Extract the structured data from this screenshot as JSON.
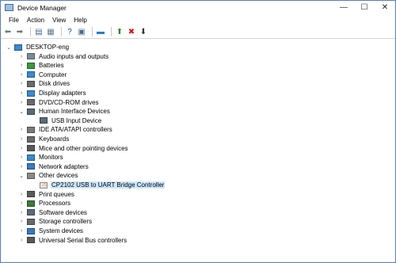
{
  "window": {
    "title": "Device Manager"
  },
  "menu": [
    "File",
    "Action",
    "View",
    "Help"
  ],
  "toolbar": [
    {
      "name": "back-arrow-icon",
      "glyph": "⬅",
      "color": "#6a7a8a"
    },
    {
      "name": "forward-arrow-icon",
      "glyph": "➡",
      "color": "#6a7a8a"
    },
    {
      "sep": true
    },
    {
      "name": "properties-icon",
      "glyph": "▤",
      "color": "#4a6a8a"
    },
    {
      "name": "show-hide-tree-icon",
      "glyph": "▦",
      "color": "#6a7a8a"
    },
    {
      "sep": true
    },
    {
      "name": "help-icon",
      "glyph": "?",
      "color": "#1a4fa0"
    },
    {
      "name": "console-icon",
      "glyph": "▣",
      "color": "#4a6a8a"
    },
    {
      "sep": true
    },
    {
      "name": "scan-hardware-icon",
      "glyph": "▬",
      "color": "#2a7ad0"
    },
    {
      "sep": true
    },
    {
      "name": "update-driver-icon",
      "glyph": "⬆",
      "color": "#2a8a3a"
    },
    {
      "name": "uninstall-icon",
      "glyph": "✖",
      "color": "#d01818"
    },
    {
      "name": "disable-icon",
      "glyph": "⬇",
      "color": "#333333"
    }
  ],
  "tree": {
    "root": "DESKTOP-eng",
    "items": [
      {
        "label": "Audio inputs and outputs",
        "icon": "speaker-icon",
        "color": "#7a8a99",
        "state": "collapsed",
        "level": 1
      },
      {
        "label": "Batteries",
        "icon": "battery-icon",
        "color": "#3a9a3a",
        "state": "collapsed",
        "level": 1
      },
      {
        "label": "Computer",
        "icon": "computer-icon",
        "color": "#3a8ad0",
        "state": "collapsed",
        "level": 1
      },
      {
        "label": "Disk drives",
        "icon": "disk-drive-icon",
        "color": "#6a6a6a",
        "state": "collapsed",
        "level": 1
      },
      {
        "label": "Display adapters",
        "icon": "display-adapter-icon",
        "color": "#3a8ad0",
        "state": "collapsed",
        "level": 1
      },
      {
        "label": "DVD/CD-ROM drives",
        "icon": "dvd-drive-icon",
        "color": "#6a6a6a",
        "state": "collapsed",
        "level": 1
      },
      {
        "label": "Human Interface Devices",
        "icon": "hid-icon",
        "color": "#5a6a7a",
        "state": "expanded",
        "level": 1
      },
      {
        "label": "USB Input Device",
        "icon": "usb-input-device-icon",
        "color": "#5a6a7a",
        "state": "leaf",
        "level": 2
      },
      {
        "label": "IDE ATA/ATAPI controllers",
        "icon": "ide-controller-icon",
        "color": "#7a7a7a",
        "state": "collapsed",
        "level": 1
      },
      {
        "label": "Keyboards",
        "icon": "keyboard-icon",
        "color": "#6a6a6a",
        "state": "collapsed",
        "level": 1
      },
      {
        "label": "Mice and other pointing devices",
        "icon": "mouse-icon",
        "color": "#5a5a5a",
        "state": "collapsed",
        "level": 1
      },
      {
        "label": "Monitors",
        "icon": "monitor-icon",
        "color": "#3a8ad0",
        "state": "collapsed",
        "level": 1
      },
      {
        "label": "Network adapters",
        "icon": "network-adapter-icon",
        "color": "#3a7ac0",
        "state": "collapsed",
        "level": 1
      },
      {
        "label": "Other devices",
        "icon": "other-devices-icon",
        "color": "#8a8a8a",
        "state": "expanded",
        "level": 1
      },
      {
        "label": "CP2102 USB to UART Bridge Controller",
        "icon": "warning-device-icon",
        "color": "#d0a020",
        "state": "leaf",
        "level": 2,
        "selected": true
      },
      {
        "label": "Print queues",
        "icon": "printer-icon",
        "color": "#5a5a5a",
        "state": "collapsed",
        "level": 1
      },
      {
        "label": "Processors",
        "icon": "processor-icon",
        "color": "#3a7a3a",
        "state": "collapsed",
        "level": 1
      },
      {
        "label": "Software devices",
        "icon": "software-device-icon",
        "color": "#5a6a7a",
        "state": "collapsed",
        "level": 1
      },
      {
        "label": "Storage controllers",
        "icon": "storage-controller-icon",
        "color": "#6a6a6a",
        "state": "collapsed",
        "level": 1
      },
      {
        "label": "System devices",
        "icon": "system-device-icon",
        "color": "#3a7ac0",
        "state": "collapsed",
        "level": 1
      },
      {
        "label": "Universal Serial Bus controllers",
        "icon": "usb-controller-icon",
        "color": "#5a5a5a",
        "state": "collapsed",
        "level": 1
      }
    ]
  }
}
